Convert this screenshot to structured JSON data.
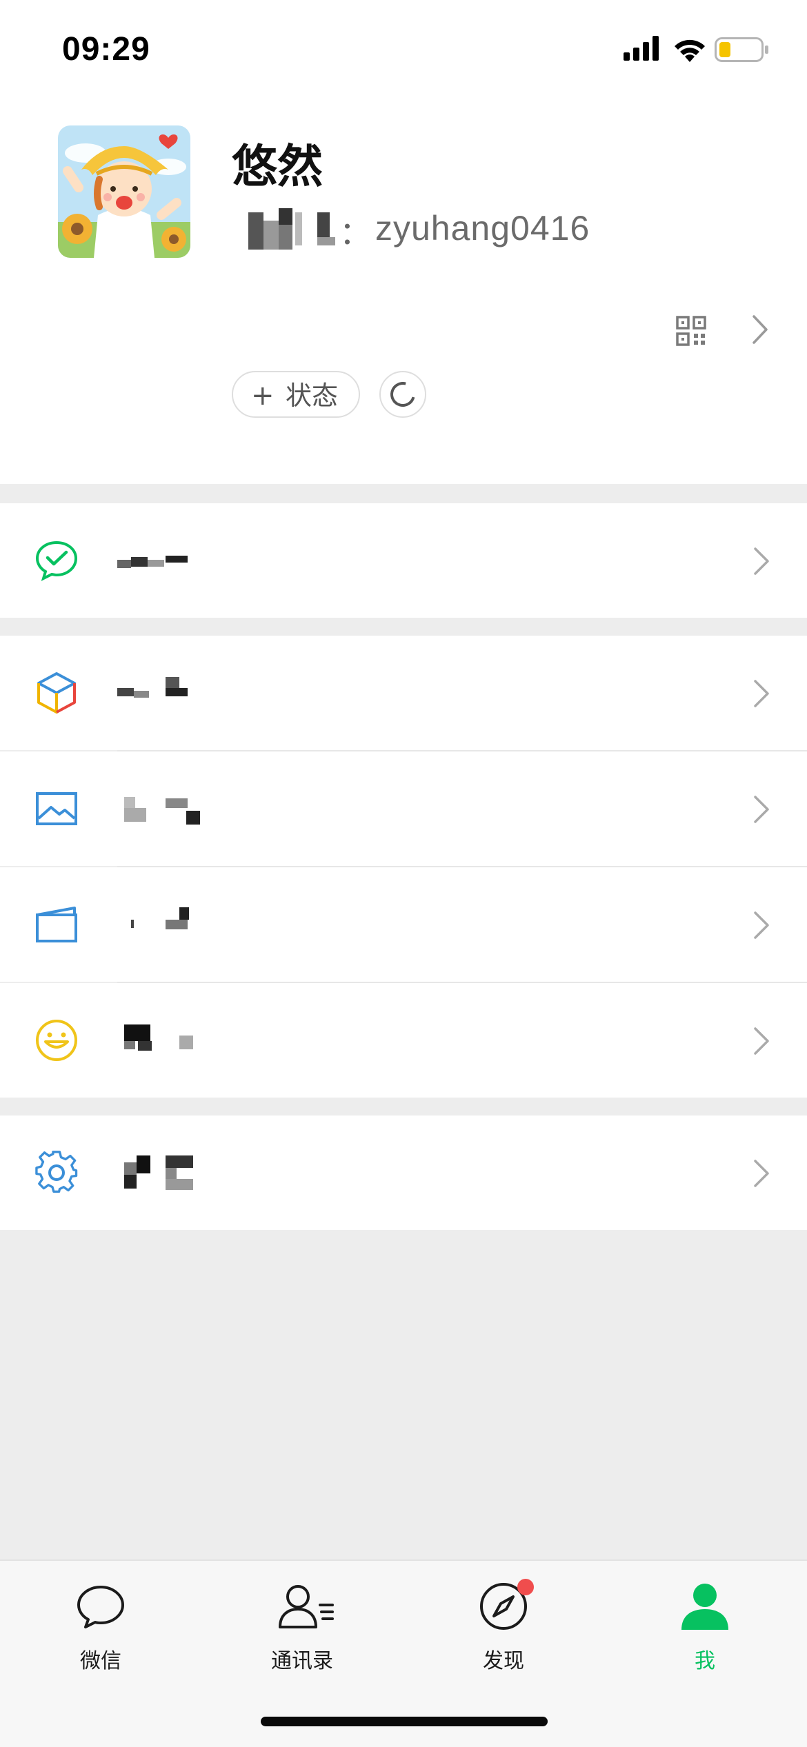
{
  "status_bar": {
    "time": "09:29"
  },
  "profile": {
    "nickname": "悠然",
    "wechat_id_separator": "：",
    "wechat_id": "zyuhang0416",
    "status_button_plus": "+",
    "status_button_label": "状态"
  },
  "menu": {
    "items": [
      {
        "icon": "wechat-pay-check-icon",
        "label": ""
      },
      {
        "icon": "favorites-cube-icon",
        "label": ""
      },
      {
        "icon": "moments-album-icon",
        "label": ""
      },
      {
        "icon": "cards-wallet-icon",
        "label": ""
      },
      {
        "icon": "sticker-smile-icon",
        "label": ""
      },
      {
        "icon": "settings-gear-icon",
        "label": ""
      }
    ]
  },
  "tab_bar": {
    "tabs": [
      {
        "label": "微信",
        "icon": "chat-bubble-icon",
        "active": false
      },
      {
        "label": "通讯录",
        "icon": "contacts-icon",
        "active": false
      },
      {
        "label": "发现",
        "icon": "compass-icon",
        "active": false,
        "badge": true
      },
      {
        "label": "我",
        "icon": "person-icon",
        "active": true
      }
    ]
  },
  "colors": {
    "accent": "#07c160",
    "badge": "#f04d4d",
    "background": "#ededed",
    "row_background": "#ffffff"
  }
}
